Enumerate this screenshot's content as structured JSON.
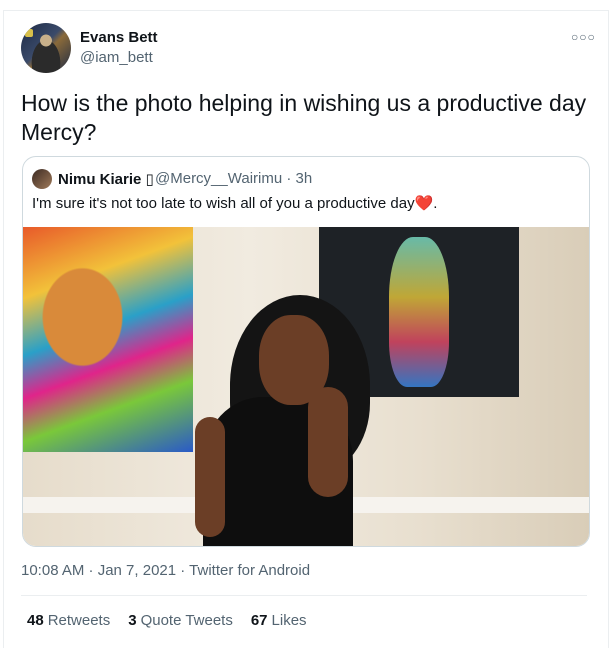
{
  "author": {
    "name": "Evans Bett",
    "handle": "@iam_bett"
  },
  "more_icon": "more-options-icon",
  "tweet": {
    "text": "How is the photo helping in wishing us a productive day Mercy?"
  },
  "quoted": {
    "name": "Nimu Kiarie",
    "badge": "▯",
    "handle": "@Mercy__Wairimu · 3h",
    "text": "I'm sure it's not too late to wish all of you a productive day",
    "emoji": "❤️",
    "text_end": "."
  },
  "meta": {
    "timestamp": "10:08 AM · Jan 7, 2021 · Twitter for Android"
  },
  "stats": {
    "retweets_count": "48",
    "retweets_label": "Retweets",
    "quote_tweets_count": "3",
    "quote_tweets_label": "Quote Tweets",
    "likes_count": "67",
    "likes_label": "Likes"
  },
  "colors": {
    "text_primary": "#0f1419",
    "text_secondary": "#536471",
    "heart": "#e0245e",
    "border": "#cfd9de"
  }
}
